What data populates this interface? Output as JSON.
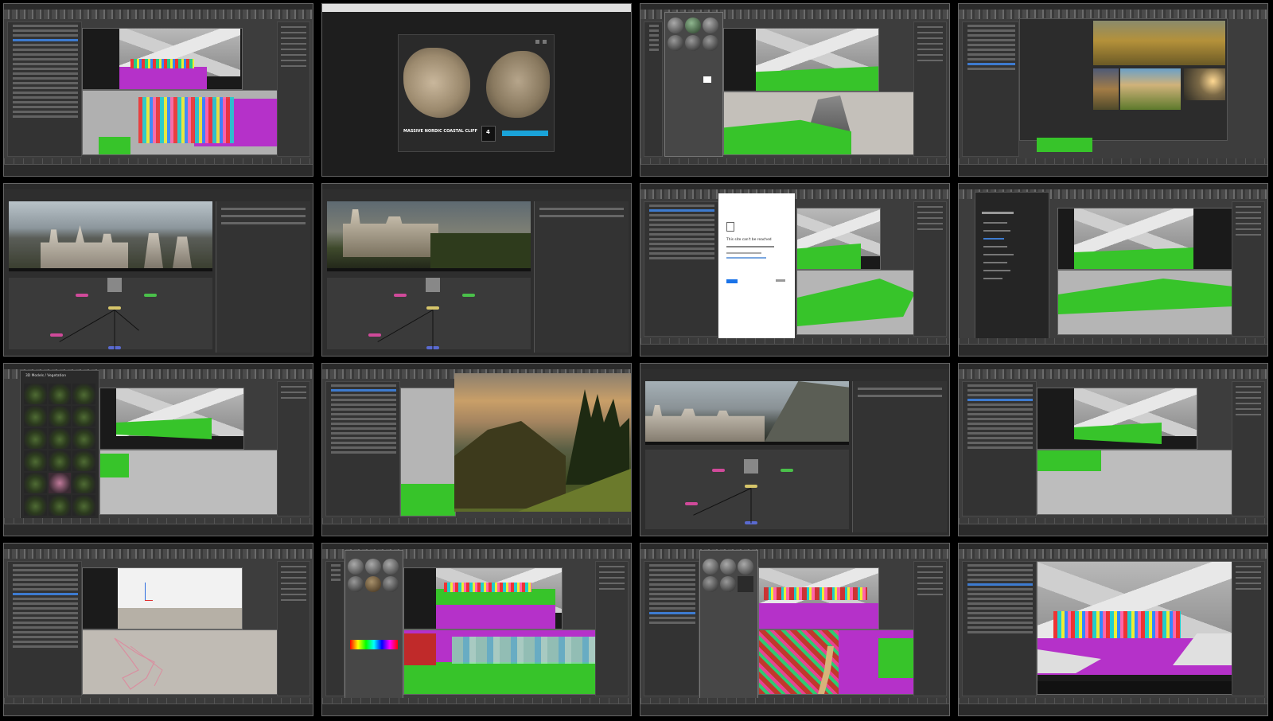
{
  "window": {
    "layout": "contact-sheet",
    "rows": 4,
    "columns": 4
  },
  "tiles": [
    {
      "app": "3ds-max",
      "content": "scene-explorer-and-two-viewports"
    },
    {
      "app": "web-browser",
      "content": "asset-preview",
      "asset_title": "MASSIVE NORDIC COASTAL CLIFF",
      "counter_value": "4",
      "primary_button_icon": "download-icon"
    },
    {
      "app": "3ds-max",
      "content": "material-editor-and-viewports"
    },
    {
      "app": "3ds-max",
      "content": "reference-images-viewer"
    },
    {
      "app": "compositor",
      "content": "castle-render-node-graph"
    },
    {
      "app": "compositor",
      "content": "castle-render-node-graph-variant"
    },
    {
      "app": "3ds-max",
      "content": "browser-error-dialog",
      "error_heading": "This site can't be reached"
    },
    {
      "app": "3ds-max",
      "content": "file-browser-sidebar"
    },
    {
      "app": "3ds-max",
      "content": "asset-library-panel",
      "library_heading": "3D Models / Vegetation"
    },
    {
      "app": "image-viewer",
      "content": "forest-hill-photo-over-3ds-max"
    },
    {
      "app": "compositor",
      "content": "castle-valley-render-node-graph"
    },
    {
      "app": "3ds-max",
      "content": "scene-explorer-and-viewports"
    },
    {
      "app": "3ds-max",
      "content": "rigging-viewport"
    },
    {
      "app": "3ds-max",
      "content": "material-editor-color-picker"
    },
    {
      "app": "3ds-max",
      "content": "material-editor-city-scene"
    },
    {
      "app": "3ds-max",
      "content": "single-large-viewport"
    }
  ],
  "colors": {
    "background": "#000000",
    "ui_dark": "#3d3d3d",
    "placeholder_purple": "#b531c9",
    "placeholder_green": "#37c42a",
    "accent_cyan": "#1aa3d9",
    "selection_blue": "#3d7bd0"
  }
}
